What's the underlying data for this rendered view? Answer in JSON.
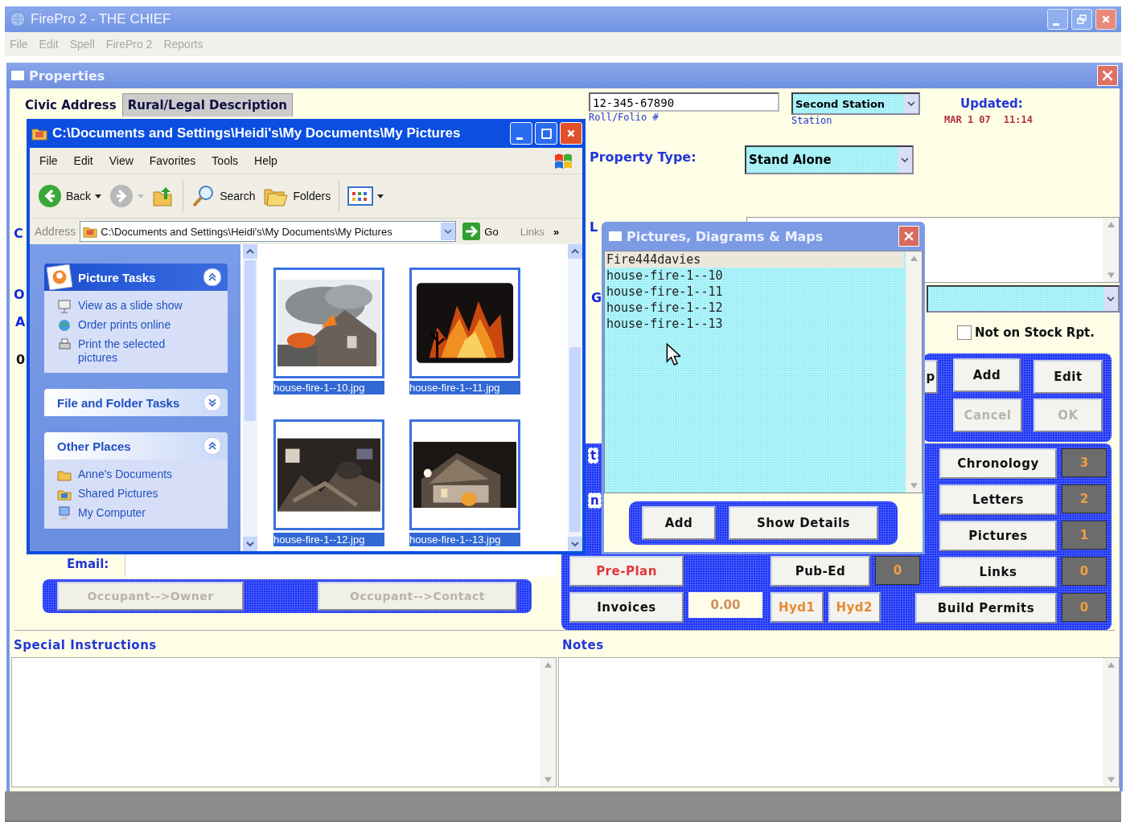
{
  "app": {
    "title": "FirePro 2 - THE CHIEF",
    "menu": [
      "File",
      "Edit",
      "Spell",
      "FirePro 2",
      "Reports"
    ]
  },
  "properties": {
    "title": "Properties",
    "tabs": [
      {
        "label": "Civic Address",
        "selected": true
      },
      {
        "label": "Rural/Legal Description",
        "selected": false
      }
    ],
    "roll_folio": {
      "value": "12-345-67890",
      "label": "Roll/Folio #"
    },
    "station": {
      "value": "Second Station",
      "label": "Station"
    },
    "updated": {
      "label": "Updated:",
      "date": "MAR 1 07",
      "time": "11:14"
    },
    "property_type": {
      "label": "Property Type:",
      "value": "Stand Alone"
    },
    "left_fragments": [
      "C",
      "O",
      "A",
      "0"
    ],
    "right_fragments": [
      "L",
      "G",
      "t",
      "n"
    ],
    "stock_report": {
      "label": "Not on Stock Rpt.",
      "checked": false
    },
    "edit_buttons": [
      {
        "label": "p",
        "disabled": false
      },
      {
        "label": "Add",
        "disabled": false
      },
      {
        "label": "Edit",
        "disabled": false
      },
      {
        "label": "Cancel",
        "disabled": true
      },
      {
        "label": "OK",
        "disabled": true
      }
    ],
    "records": [
      {
        "label": "Chronology",
        "count": "3"
      },
      {
        "label": "Letters",
        "count": "2"
      },
      {
        "label": "Pictures",
        "count": "1"
      },
      {
        "label": "Links",
        "count": "0"
      },
      {
        "label": "Build Permits",
        "count": "0"
      }
    ],
    "action_row_1": [
      {
        "kind": "button",
        "label": "Pre-Plan",
        "color": "#e03838"
      },
      {
        "kind": "gap"
      },
      {
        "kind": "button",
        "label": "Pub-Ed"
      },
      {
        "kind": "count",
        "value": "0"
      }
    ],
    "action_row_2": [
      {
        "kind": "button",
        "label": "Invoices"
      },
      {
        "kind": "amount",
        "value": "0.00"
      },
      {
        "kind": "button",
        "label": "Hyd1",
        "color": "#e88a30"
      },
      {
        "kind": "button",
        "label": "Hyd2",
        "color": "#e88a30"
      }
    ],
    "email": {
      "label": "Email:"
    },
    "occupant_buttons": [
      {
        "label": "Occupant-->Owner",
        "disabled": true
      },
      {
        "label": "Occupant-->Contact",
        "disabled": true
      }
    ],
    "special_instructions": {
      "label": "Special Instructions"
    },
    "notes": {
      "label": "Notes"
    }
  },
  "explorer": {
    "title": "C:\\Documents and Settings\\Heidi's\\My Documents\\My Pictures",
    "menu": [
      "File",
      "Edit",
      "View",
      "Favorites",
      "Tools",
      "Help"
    ],
    "toolbar": {
      "back": "Back",
      "search": "Search",
      "folders": "Folders"
    },
    "address": {
      "label": "Address",
      "value": "C:\\Documents and Settings\\Heidi's\\My Documents\\My Pictures",
      "go": "Go",
      "links": "Links",
      "more": "»"
    },
    "task_panels": [
      {
        "title": "Picture Tasks",
        "kind": "special",
        "expanded": true,
        "items": [
          "View as a slide show",
          "Order prints online",
          "Print the selected pictures"
        ]
      },
      {
        "title": "File and Folder Tasks",
        "kind": "plain",
        "expanded": false
      },
      {
        "title": "Other Places",
        "kind": "plain",
        "expanded": true,
        "items": [
          "Anne's Documents",
          "Shared Pictures",
          "My Computer"
        ]
      }
    ],
    "files": [
      {
        "name": "house-fire-1--10.jpg",
        "selected": true
      },
      {
        "name": "house-fire-1--11.jpg",
        "selected": true
      },
      {
        "name": "house-fire-1--12.jpg",
        "selected": true
      },
      {
        "name": "house-fire-1--13.jpg",
        "selected": true
      }
    ]
  },
  "pictures_dialog": {
    "title": "Pictures, Diagrams & Maps",
    "items": [
      {
        "label": "Fire444davies",
        "selected": true
      },
      {
        "label": "house-fire-1--10",
        "selected": false
      },
      {
        "label": "house-fire-1--11",
        "selected": false
      },
      {
        "label": "house-fire-1--12",
        "selected": false
      },
      {
        "label": "house-fire-1--13",
        "selected": false
      }
    ],
    "buttons": [
      "Add",
      "Show Details"
    ]
  }
}
